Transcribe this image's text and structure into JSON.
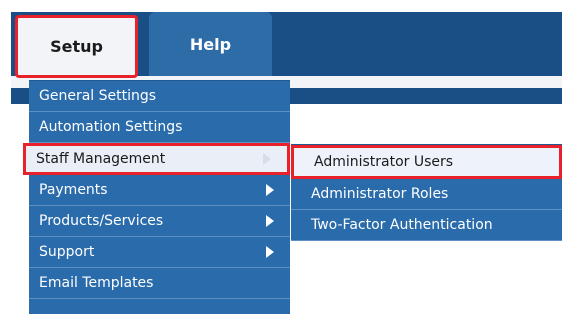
{
  "nav": {
    "tabs": [
      {
        "label": "Setup"
      },
      {
        "label": "Help"
      }
    ]
  },
  "setup_menu": {
    "items": [
      {
        "label": "General Settings",
        "has_submenu": false
      },
      {
        "label": "Automation Settings",
        "has_submenu": false
      },
      {
        "label": "Staff Management",
        "has_submenu": true,
        "highlighted": true
      },
      {
        "label": "Payments",
        "has_submenu": true
      },
      {
        "label": "Products/Services",
        "has_submenu": true
      },
      {
        "label": "Support",
        "has_submenu": true
      },
      {
        "label": "Email Templates",
        "has_submenu": false
      }
    ]
  },
  "staff_submenu": {
    "items": [
      {
        "label": "Administrator Users",
        "highlighted": true
      },
      {
        "label": "Administrator Roles"
      },
      {
        "label": "Two-Factor Authentication"
      }
    ]
  },
  "colors": {
    "nav_bar": "#1a4f85",
    "menu_bg": "#2a6bab",
    "highlight_border": "#e8222b",
    "highlight_bg": "#e9eef7"
  }
}
